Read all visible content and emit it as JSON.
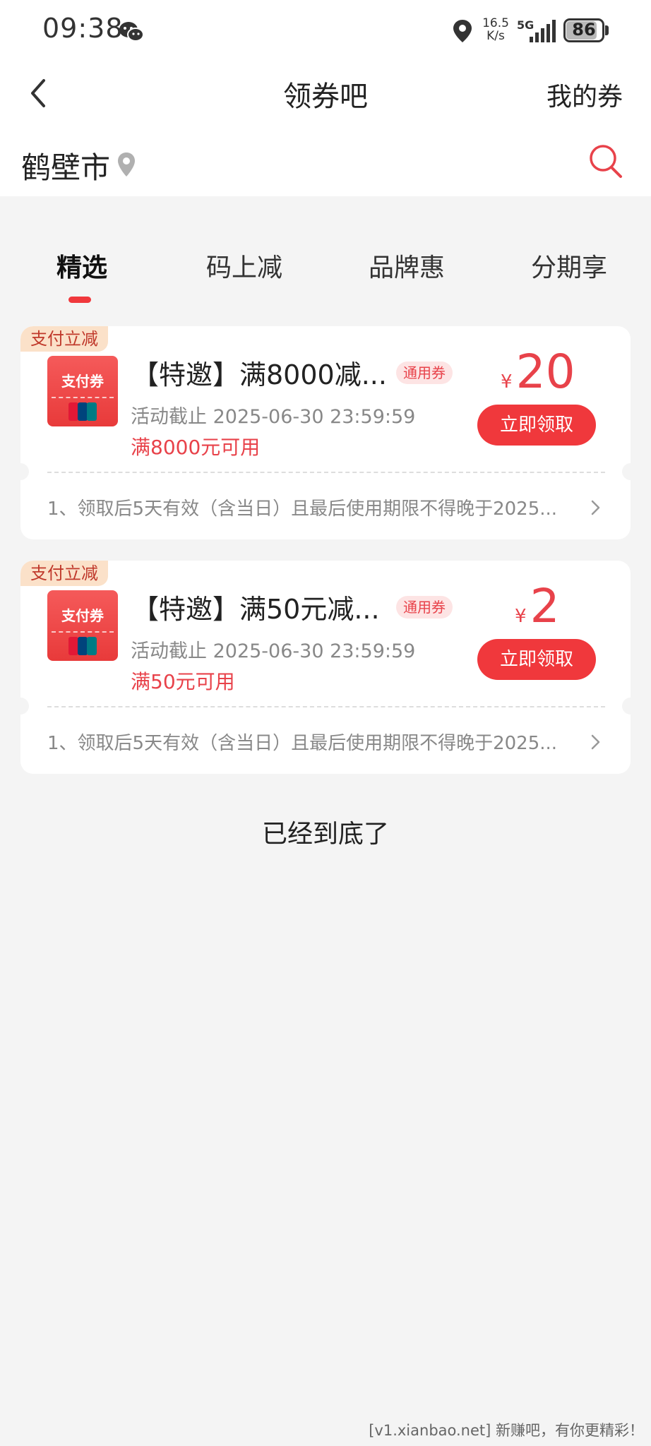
{
  "status": {
    "time": "09:38",
    "speed_value": "16.5",
    "speed_unit": "K/s",
    "network": "5G",
    "battery": "86"
  },
  "nav": {
    "title": "领券吧",
    "my_coupons": "我的券"
  },
  "location": {
    "city": "鹤壁市"
  },
  "tabs": [
    {
      "label": "精选"
    },
    {
      "label": "码上减"
    },
    {
      "label": "品牌惠"
    },
    {
      "label": "分期享"
    }
  ],
  "coupons": [
    {
      "tag": "支付立减",
      "thumb_text": "支付券",
      "name": "【特邀】满8000减...",
      "badge": "通用券",
      "deadline": "活动截止 2025-06-30 23:59:59",
      "condition": "满8000元可用",
      "currency": "¥",
      "amount": "20",
      "button": "立即领取",
      "rule": "1、领取后5天有效（含当日）且最后使用期限不得晚于2025..."
    },
    {
      "tag": "支付立减",
      "thumb_text": "支付券",
      "name": "【特邀】满50元减...",
      "badge": "通用券",
      "deadline": "活动截止 2025-06-30 23:59:59",
      "condition": "满50元可用",
      "currency": "¥",
      "amount": "2",
      "button": "立即领取",
      "rule": "1、领取后5天有效（含当日）且最后使用期限不得晚于2025..."
    }
  ],
  "end_text": "已经到底了",
  "watermark": "[v1.xianbao.net] 新赚吧，有你更精彩！",
  "colors": {
    "accent": "#f0383c",
    "page_bg": "#f4f4f4",
    "tag_bg": "#fbe1c9"
  }
}
